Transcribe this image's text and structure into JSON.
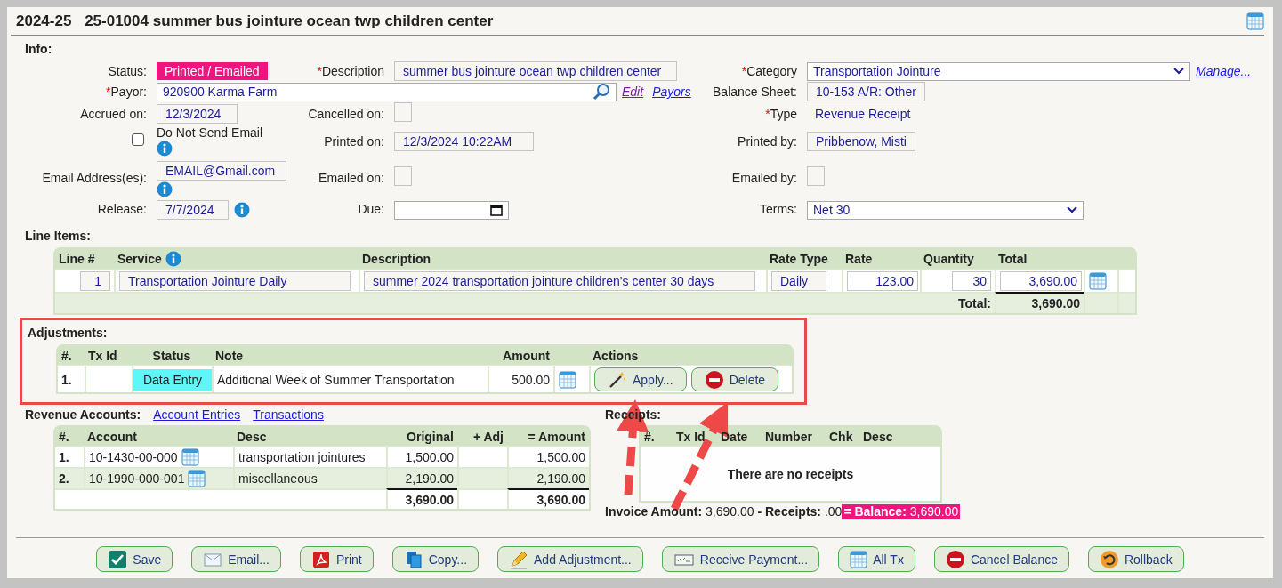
{
  "title": {
    "year": "2024-25",
    "text": "25-01004 summer bus jointure ocean twp children center"
  },
  "info": {
    "heading": "Info:",
    "status": {
      "label": "Status:",
      "value": "Printed / Emailed"
    },
    "description": {
      "mark": "*",
      "label": "Description",
      "value": "summer bus jointure ocean twp children center"
    },
    "category": {
      "mark": "*",
      "label": "Category",
      "value": "Transportation Jointure",
      "link": "Manage..."
    },
    "payor": {
      "mark": "*",
      "label": "Payor:",
      "value": "920900 Karma Farm",
      "links": [
        {
          "label": "Edit",
          "visited": true
        },
        {
          "label": "Payors",
          "visited": false
        }
      ]
    },
    "balance_sheet": {
      "label": "Balance Sheet:",
      "value": "10-153 A/R: Other"
    },
    "accrued_on": {
      "label": "Accrued on:",
      "value": "12/3/2024"
    },
    "cancelled_on": {
      "label": "Cancelled on:"
    },
    "type": {
      "mark": "*",
      "label": "Type",
      "value": "Revenue Receipt"
    },
    "do_not_send_email": {
      "label": "Do Not Send Email",
      "checked": false
    },
    "printed_on": {
      "label": "Printed on:",
      "value": "12/3/2024 10:22AM"
    },
    "printed_by": {
      "label": "Printed by:",
      "value": "Pribbenow, Misti"
    },
    "email": {
      "label": "Email Address(es):",
      "value": "EMAIL@Gmail.com"
    },
    "emailed_on": {
      "label": "Emailed on:"
    },
    "emailed_by": {
      "label": "Emailed by:"
    },
    "release": {
      "label": "Release:",
      "value": "7/7/2024"
    },
    "due": {
      "label": "Due:"
    },
    "terms": {
      "label": "Terms:",
      "value": "Net 30"
    }
  },
  "line_items": {
    "heading": "Line Items:",
    "columns": [
      {
        "label": "Line #",
        "info": false
      },
      {
        "label": "Service",
        "info": true
      },
      {
        "label": "Description",
        "info": false
      },
      {
        "label": "Rate Type",
        "info": false
      },
      {
        "label": "Rate",
        "info": false
      },
      {
        "label": "Quantity",
        "info": false
      },
      {
        "label": "Total",
        "info": false
      }
    ],
    "rows": [
      {
        "line": "1",
        "service": "Transportation Jointure Daily",
        "description": "summer 2024 transportation jointure children's center 30 days",
        "rate_type": "Daily",
        "rate": "123.00",
        "quantity": "30",
        "total": "3,690.00"
      }
    ],
    "total_label": "Total:",
    "total": "3,690.00"
  },
  "adjustments": {
    "heading": "Adjustments:",
    "columns": [
      "#.",
      "Tx Id",
      "Status",
      "Note",
      "Amount",
      "Actions"
    ],
    "rows": [
      {
        "num": "1.",
        "status": "Data Entry",
        "color": "#5ef7f7",
        "note": "Additional Week of Summer Transportation",
        "amount": "500.00",
        "actions": [
          "Apply...",
          "Delete"
        ]
      }
    ]
  },
  "revenue_accounts": {
    "heading": "Revenue Accounts:",
    "links": [
      "Account Entries",
      "Transactions"
    ],
    "columns": [
      "#.",
      "Account",
      "Desc",
      "Original",
      "+ Adj",
      "= Amount"
    ],
    "rows": [
      {
        "num": "1.",
        "account": "10-1430-00-000",
        "desc": "transportation jointures",
        "original": "1,500.00",
        "amount": "1,500.00"
      },
      {
        "num": "2.",
        "account": "10-1990-000-001",
        "desc": "miscellaneous",
        "original": "2,190.00",
        "amount": "2,190.00"
      }
    ],
    "totals": {
      "original": "3,690.00",
      "amount": "3,690.00"
    }
  },
  "receipts": {
    "heading": "Receipts:",
    "columns": [
      "#.",
      "Tx Id",
      "Date",
      "Number",
      "Chk",
      "Desc"
    ],
    "empty_message": "There are no receipts",
    "summary": "**Invoice Amount:** 3,690.00 **- Receipts:** .00",
    "balance": "**= Balance:** 3,690.00"
  },
  "buttons": [
    "Save",
    "Email...",
    "Print",
    "Copy...",
    "Add Adjustment...",
    "Receive Payment...",
    "All Tx",
    "Cancel Balance",
    "Rollback"
  ]
}
